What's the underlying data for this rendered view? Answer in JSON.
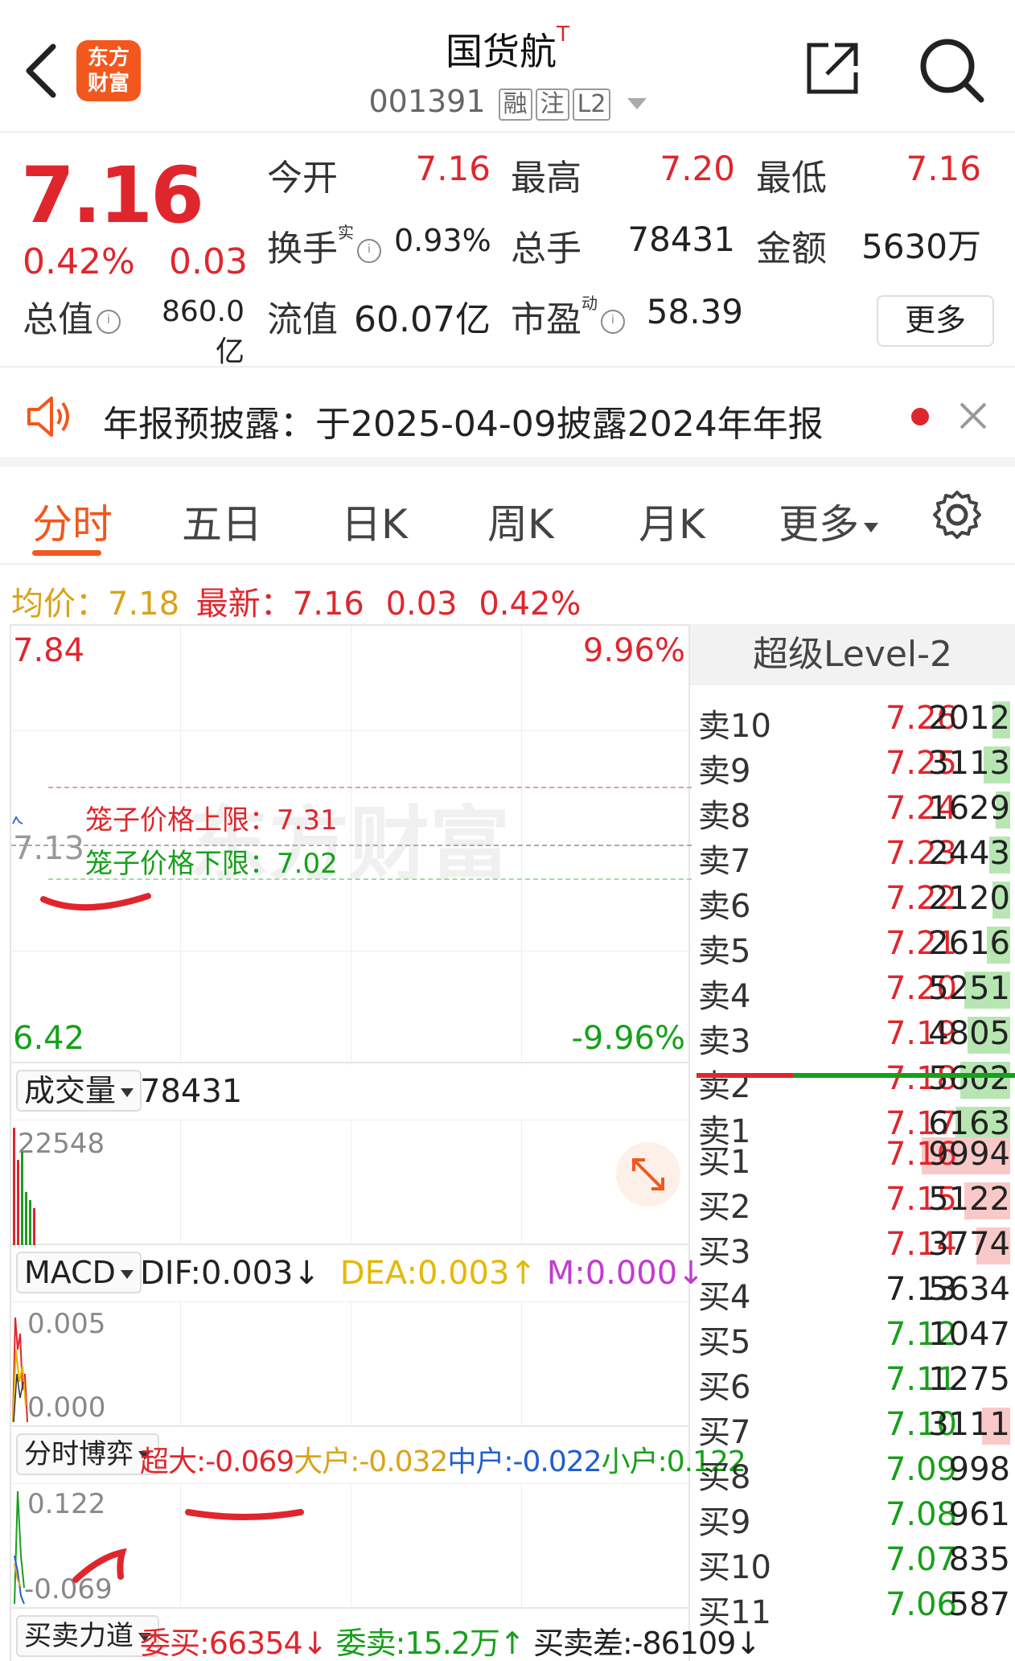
{
  "header": {
    "logo_line1": "东方",
    "logo_line2": "财富",
    "stock_name": "国货航",
    "stock_name_sup": "T",
    "stock_code": "001391",
    "tags": [
      "融",
      "注",
      "L2"
    ]
  },
  "quote": {
    "price": "7.16",
    "change_pct": "0.42%",
    "change_abs": "0.03",
    "open_label": "今开",
    "open_value": "7.16",
    "high_label": "最高",
    "high_value": "7.20",
    "low_label": "最低",
    "low_value": "7.16",
    "turnover_label": "换手",
    "turnover_sup": "实",
    "turnover_value": "0.93%",
    "volume_label": "总手",
    "volume_value": "78431",
    "amount_label": "金额",
    "amount_value": "5630万",
    "mktcap_label": "总值",
    "mktcap_value": "860.0亿",
    "float_label": "流值",
    "float_value": "60.07亿",
    "pe_label": "市盈",
    "pe_sup": "动",
    "pe_value": "58.39",
    "more_label": "更多"
  },
  "notice": {
    "text": "年报预披露：于2025-04-09披露2024年年报"
  },
  "tabs": [
    "分时",
    "五日",
    "日K",
    "周K",
    "月K",
    "更多"
  ],
  "legend": {
    "avg_label": "均价：",
    "avg_value": "7.18",
    "latest_label": "最新：",
    "latest_value": "7.16",
    "latest_change": "0.03",
    "latest_pct": "0.42%"
  },
  "price_chart": {
    "y_max": "7.84",
    "y_max_pct": "9.96%",
    "y_min": "6.42",
    "y_min_pct": "-9.96%",
    "prev_close": "7.13",
    "cage_upper_label": "笼子价格上限：7.31",
    "cage_lower_label": "笼子价格下限：7.02",
    "watermark": "东方财富"
  },
  "volume_panel": {
    "selector": "成交量",
    "total": "78431",
    "max_label": "22548"
  },
  "macd_panel": {
    "selector": "MACD",
    "dif": "DIF:0.003",
    "dea": "DEA:0.003",
    "m": "M:0.000",
    "top": "0.005",
    "bottom": "0.000"
  },
  "game_panel": {
    "selector": "分时博弈",
    "super": "超大:-0.069",
    "big": "大户:-0.032",
    "mid": "中户:-0.022",
    "small": "小户:0.122",
    "top": "0.122",
    "bottom": "-0.069"
  },
  "force_panel": {
    "selector": "买卖力道",
    "bid": "委买:66354",
    "ask": "委卖:15.2万",
    "diff": "买卖差:-86109"
  },
  "order_book": {
    "title": "超级Level-2",
    "asks": [
      {
        "label": "卖10",
        "price": "7.26",
        "vol": "2012",
        "bar": 0.1
      },
      {
        "label": "卖9",
        "price": "7.25",
        "vol": "3113",
        "bar": 0.15
      },
      {
        "label": "卖8",
        "price": "7.24",
        "vol": "1629",
        "bar": 0.08
      },
      {
        "label": "卖7",
        "price": "7.23",
        "vol": "2443",
        "bar": 0.12
      },
      {
        "label": "卖6",
        "price": "7.22",
        "vol": "2120",
        "bar": 0.1
      },
      {
        "label": "卖5",
        "price": "7.21",
        "vol": "2616",
        "bar": 0.13
      },
      {
        "label": "卖4",
        "price": "7.20",
        "vol": "5251",
        "bar": 0.26
      },
      {
        "label": "卖3",
        "price": "7.19",
        "vol": "4805",
        "bar": 0.24
      },
      {
        "label": "卖2",
        "price": "7.18",
        "vol": "5602",
        "bar": 0.28
      },
      {
        "label": "卖1",
        "price": "7.17",
        "vol": "6163",
        "bar": 0.31
      }
    ],
    "bids": [
      {
        "label": "买1",
        "price": "7.16",
        "vol": "9994",
        "bar": 0.5,
        "color": "red"
      },
      {
        "label": "买2",
        "price": "7.15",
        "vol": "5122",
        "bar": 0.26,
        "color": "red"
      },
      {
        "label": "买3",
        "price": "7.14",
        "vol": "3774",
        "bar": 0.19,
        "color": "red"
      },
      {
        "label": "买4",
        "price": "7.13",
        "vol": "5634",
        "bar": 0,
        "color": "black"
      },
      {
        "label": "买5",
        "price": "7.12",
        "vol": "1047",
        "bar": 0,
        "color": "green"
      },
      {
        "label": "买6",
        "price": "7.11",
        "vol": "1275",
        "bar": 0,
        "color": "green"
      },
      {
        "label": "买7",
        "price": "7.10",
        "vol": "3111",
        "bar": 0.16,
        "color": "green"
      },
      {
        "label": "买8",
        "price": "7.09",
        "vol": "998",
        "bar": 0,
        "color": "green"
      },
      {
        "label": "买9",
        "price": "7.08",
        "vol": "961",
        "bar": 0,
        "color": "green"
      },
      {
        "label": "买10",
        "price": "7.07",
        "vol": "835",
        "bar": 0,
        "color": "green"
      },
      {
        "label": "买11",
        "price": "7.06",
        "vol": "587",
        "bar": 0,
        "color": "green"
      }
    ]
  },
  "colors": {
    "accent": "#f2571d",
    "up": "#e0262d",
    "down": "#17a01b",
    "avg": "#d9a31a",
    "dea": "#e6b800",
    "m": "#c13ccf",
    "mid": "#1f5fd1"
  }
}
